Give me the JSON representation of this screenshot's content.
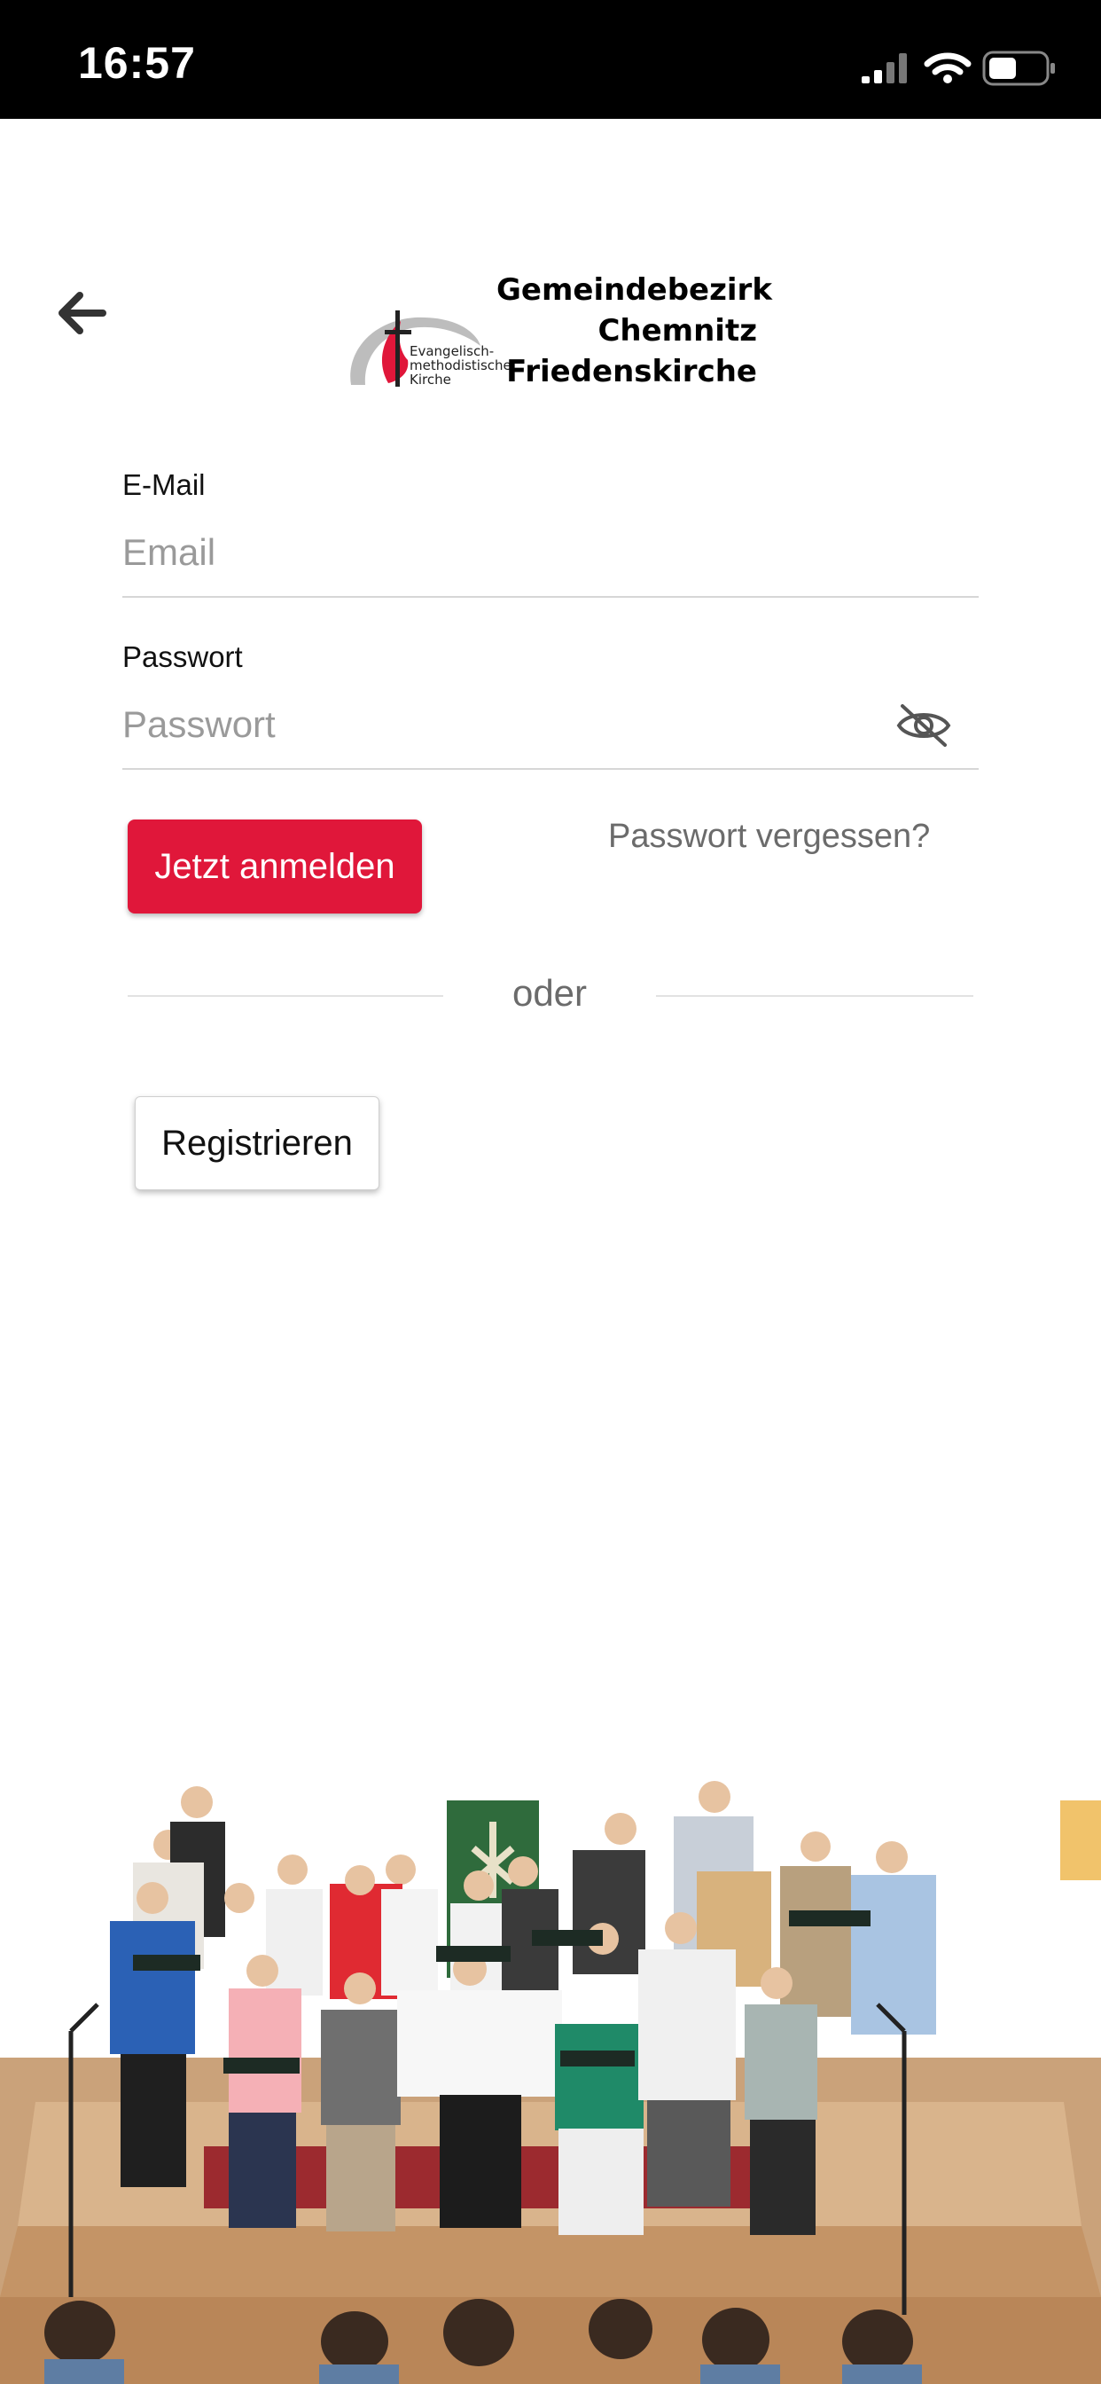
{
  "status_bar": {
    "time": "16:57"
  },
  "header": {
    "logo_text": [
      "Evangelisch-",
      "methodistische",
      "Kirche"
    ],
    "title_lines": [
      "Gemeindebezirk",
      "Chemnitz",
      "Friedenskirche"
    ]
  },
  "form": {
    "email_label": "E-Mail",
    "email_placeholder": "Email",
    "email_value": "",
    "password_label": "Passwort",
    "password_placeholder": "Passwort",
    "password_value": ""
  },
  "actions": {
    "login_label": "Jetzt anmelden",
    "forgot_label": "Passwort vergessen?",
    "divider_label": "oder",
    "register_label": "Registrieren"
  },
  "colors": {
    "accent": "#e0173a",
    "status_bar": "#000000",
    "muted_text": "#6b6b6b"
  },
  "icons": {
    "back": "arrow-left-icon",
    "password_visibility": "eye-off-icon",
    "signal": "cellular-signal-icon",
    "wifi": "wifi-icon",
    "battery": "battery-icon"
  }
}
